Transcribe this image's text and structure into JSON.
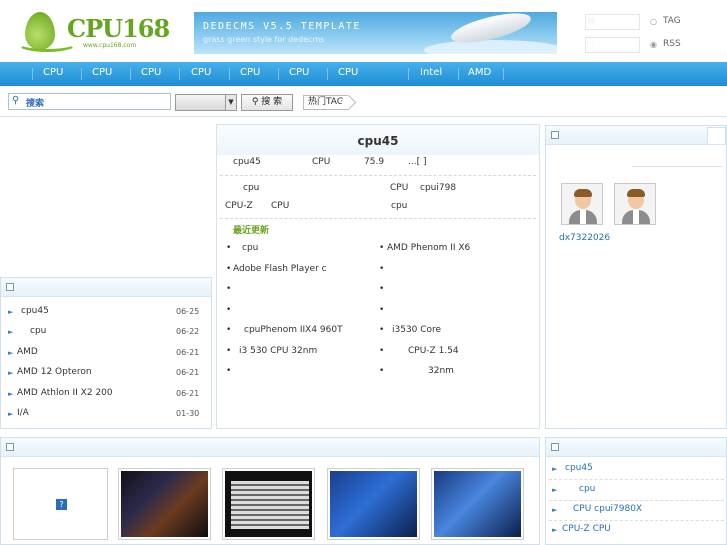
{
  "header": {
    "logo_text": "CPU168",
    "logo_url": "www.cpu168.com",
    "banner_title": "DEDECMS V5.5 TEMPLATE",
    "banner_subtitle": "grass green style for dedecms",
    "tag_label": "TAG",
    "rss_label": "RSS"
  },
  "nav": {
    "items": [
      "CPU",
      "CPU",
      "CPU",
      "CPU",
      "CPU",
      "CPU",
      "CPU",
      "Intel",
      "AMD"
    ]
  },
  "search": {
    "icon": "magnifier-icon",
    "placeholder": "搜索",
    "button_label": "搜 索",
    "hot_tag_label": "热门TAG"
  },
  "left_list": {
    "items": [
      {
        "label": "cpu45",
        "date": "06-25"
      },
      {
        "label": "cpu",
        "date": "06-22"
      },
      {
        "label": "AMD",
        "date": "06-21"
      },
      {
        "label": "AMD 12 Opteron",
        "date": "06-21"
      },
      {
        "label": "AMD Athlon II X2 200",
        "date": "06-21"
      },
      {
        "label": "I/A",
        "date": "01-30"
      }
    ]
  },
  "center": {
    "title": "cpu45",
    "summary": {
      "a": "cpu45",
      "b": "CPU",
      "c": "75.9",
      "d": "...[ ]"
    },
    "rel_left_1": "cpu",
    "rel_left_2a": "CPU-Z",
    "rel_left_2b": "CPU",
    "rel_right_1a": "CPU",
    "rel_right_1b": "cpui798",
    "rel_right_2": "cpu",
    "latest_heading": "最近更新",
    "latest_left": [
      "cpu",
      "Adobe Flash Player      c",
      "",
      "",
      "cpuPhenom IIX4 960T",
      "i3 530 CPU  32nm",
      ""
    ],
    "latest_right": [
      "AMD Phenom II X6",
      "",
      "",
      "",
      "i3530          Core",
      "CPU-Z 1.54",
      "32nm"
    ]
  },
  "right_top": {
    "user_label": "dx7322026"
  },
  "right_bottom": {
    "items": [
      "cpu45",
      "cpu",
      "CPU    cpui7980X",
      "CPU-Z      CPU"
    ]
  }
}
